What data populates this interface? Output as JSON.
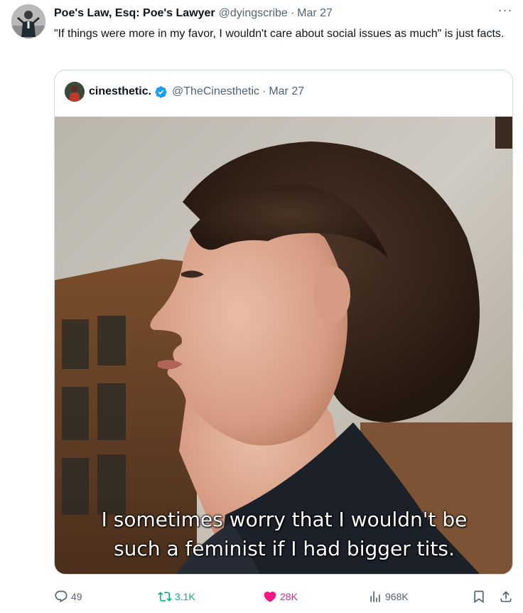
{
  "tweet": {
    "author_name": "Poe's Law, Esq: Poe's Lawyer",
    "author_handle": "@dyingscribe",
    "separator": "·",
    "date": "Mar 27",
    "more_label": "···",
    "text": "\"If things were more in my favor, I wouldn't care about social issues as much\" is just facts.",
    "avatar_icon": "profile-photo"
  },
  "quote": {
    "author_name": "cinesthetic.",
    "verified": true,
    "verified_color": "#1d9bf0",
    "author_handle": "@TheCinesthetic",
    "separator": "·",
    "date": "Mar 27",
    "media": {
      "caption_line1": "I sometimes worry that I wouldn't be",
      "caption_line2": "such a feminist if I had bigger tits."
    }
  },
  "actions": {
    "reply_count": "49",
    "retweet_count": "3.1K",
    "like_count": "28K",
    "views_count": "968K",
    "retweet_color": "#00ba7c",
    "like_color": "#f91880",
    "muted_color": "#536471"
  }
}
